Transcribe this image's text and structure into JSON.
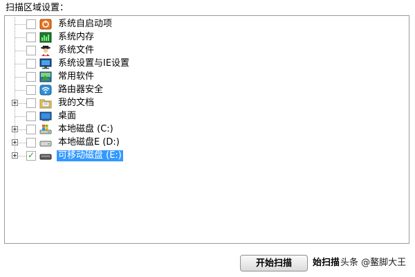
{
  "section_label": "扫描区域设置：",
  "tree": {
    "items": [
      {
        "label": "系统自启动项",
        "icon": "startup-icon",
        "checked": false,
        "expandable": false,
        "selected": false
      },
      {
        "label": "系统内存",
        "icon": "memory-icon",
        "checked": false,
        "expandable": false,
        "selected": false
      },
      {
        "label": "系统文件",
        "icon": "system-file-icon",
        "checked": false,
        "expandable": false,
        "selected": false
      },
      {
        "label": "系统设置与IE设置",
        "icon": "monitor-icon",
        "checked": false,
        "expandable": false,
        "selected": false
      },
      {
        "label": "常用软件",
        "icon": "software-icon",
        "checked": false,
        "expandable": false,
        "selected": false
      },
      {
        "label": "路由器安全",
        "icon": "router-icon",
        "checked": false,
        "expandable": false,
        "selected": false
      },
      {
        "label": "我的文档",
        "icon": "folder-icon",
        "checked": false,
        "expandable": true,
        "selected": false
      },
      {
        "label": "桌面",
        "icon": "desktop-icon",
        "checked": false,
        "expandable": false,
        "selected": false
      },
      {
        "label": "本地磁盘 (C:)",
        "icon": "system-drive-icon",
        "checked": false,
        "expandable": true,
        "selected": false
      },
      {
        "label": "本地磁盘E (D:)",
        "icon": "drive-icon",
        "checked": false,
        "expandable": true,
        "selected": false
      },
      {
        "label": "可移动磁盘 (E:)",
        "icon": "removable-drive-icon",
        "checked": true,
        "expandable": true,
        "selected": true
      }
    ]
  },
  "buttons": {
    "start_scan": "开始扫描",
    "second_partial": "始扫描"
  },
  "watermark": "头条 @鳌脚大王",
  "colors": {
    "selection": "#3399ff",
    "border": "#9a9a9a",
    "checkmark": "#2e9e3a"
  }
}
